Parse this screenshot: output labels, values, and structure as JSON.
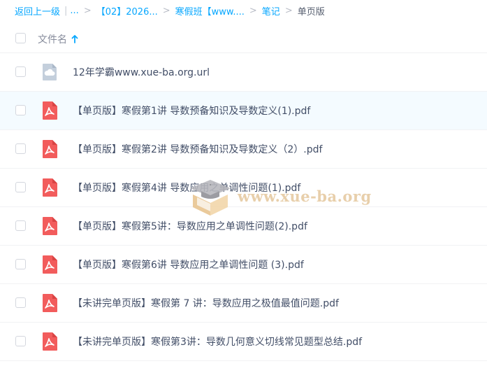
{
  "breadcrumb": {
    "back_label": "返回上一级",
    "ellipsis": "...",
    "crumbs": [
      "【02】2026...",
      "寒假班【www....",
      "笔记"
    ],
    "current": "单页版"
  },
  "header": {
    "column_label": "文件名",
    "sort_icon": "arrow-up-icon"
  },
  "files": [
    {
      "name": "12年学霸www.xue-ba.org.url",
      "type": "url",
      "icon": "cloud-link-icon",
      "highlighted": false
    },
    {
      "name": "【单页版】寒假第1讲 导数预备知识及导数定义(1).pdf",
      "type": "pdf",
      "icon": "pdf-icon",
      "highlighted": true
    },
    {
      "name": "【单页版】寒假第2讲 导数预备知识及导数定义（2）.pdf",
      "type": "pdf",
      "icon": "pdf-icon",
      "highlighted": false
    },
    {
      "name": "【单页版】寒假第4讲 导数应用之单调性问题(1).pdf",
      "type": "pdf",
      "icon": "pdf-icon",
      "highlighted": false
    },
    {
      "name": "【单页版】寒假第5讲：导数应用之单调性问题(2).pdf",
      "type": "pdf",
      "icon": "pdf-icon",
      "highlighted": false
    },
    {
      "name": "【单页版】寒假第6讲 导数应用之单调性问题 (3).pdf",
      "type": "pdf",
      "icon": "pdf-icon",
      "highlighted": false
    },
    {
      "name": "【未讲完单页版】寒假第 7 讲：导数应用之极值最值问题.pdf",
      "type": "pdf",
      "icon": "pdf-icon",
      "highlighted": false
    },
    {
      "name": "【未讲完单页版】寒假第3讲：导数几何意义切线常见题型总结.pdf",
      "type": "pdf",
      "icon": "pdf-icon",
      "highlighted": false
    }
  ],
  "watermark": {
    "text": "www.xue-ba.org",
    "icon": "graduation-cap-logo"
  },
  "colors": {
    "link": "#06a7ff",
    "pdf_red": "#f25c5c",
    "highlight_row": "#f4fbff",
    "text": "#424e67"
  }
}
